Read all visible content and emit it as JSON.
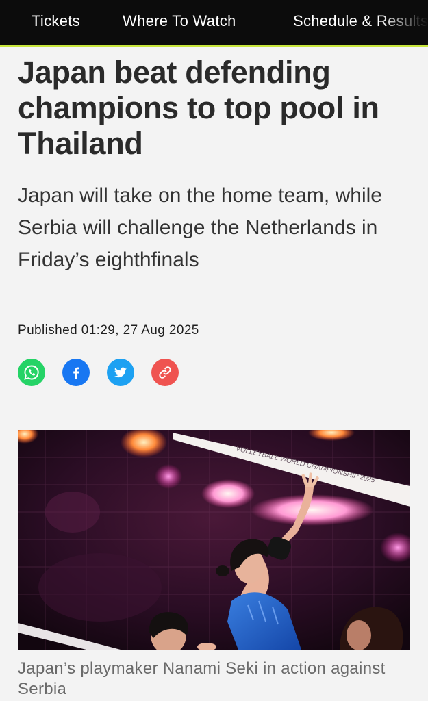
{
  "nav": {
    "items": [
      {
        "label": "Tickets"
      },
      {
        "label": "Where To Watch"
      },
      {
        "label": "Schedule & Results"
      }
    ]
  },
  "article": {
    "headline": "Japan beat defending champions to top pool in Thailand",
    "subheadline": "Japan will take on the home team, while Serbia will challenge the Netherlands in Friday’s eighthfinals",
    "published": "Published 01:29, 27 Aug 2025",
    "share": [
      {
        "name": "whatsapp",
        "icon": "whatsapp-icon",
        "color": "#25d366"
      },
      {
        "name": "facebook",
        "icon": "facebook-icon",
        "color": "#1877f2"
      },
      {
        "name": "twitter",
        "icon": "twitter-icon",
        "color": "#1da1f2"
      },
      {
        "name": "copy-link",
        "icon": "link-icon",
        "color": "#ef5350"
      }
    ],
    "photo": {
      "banner_text": "VOLLEYBALL WORLD CHAMPIONSHIP 2025"
    },
    "caption": "Japan’s playmaker Nanami Seki in action against Serbia"
  }
}
